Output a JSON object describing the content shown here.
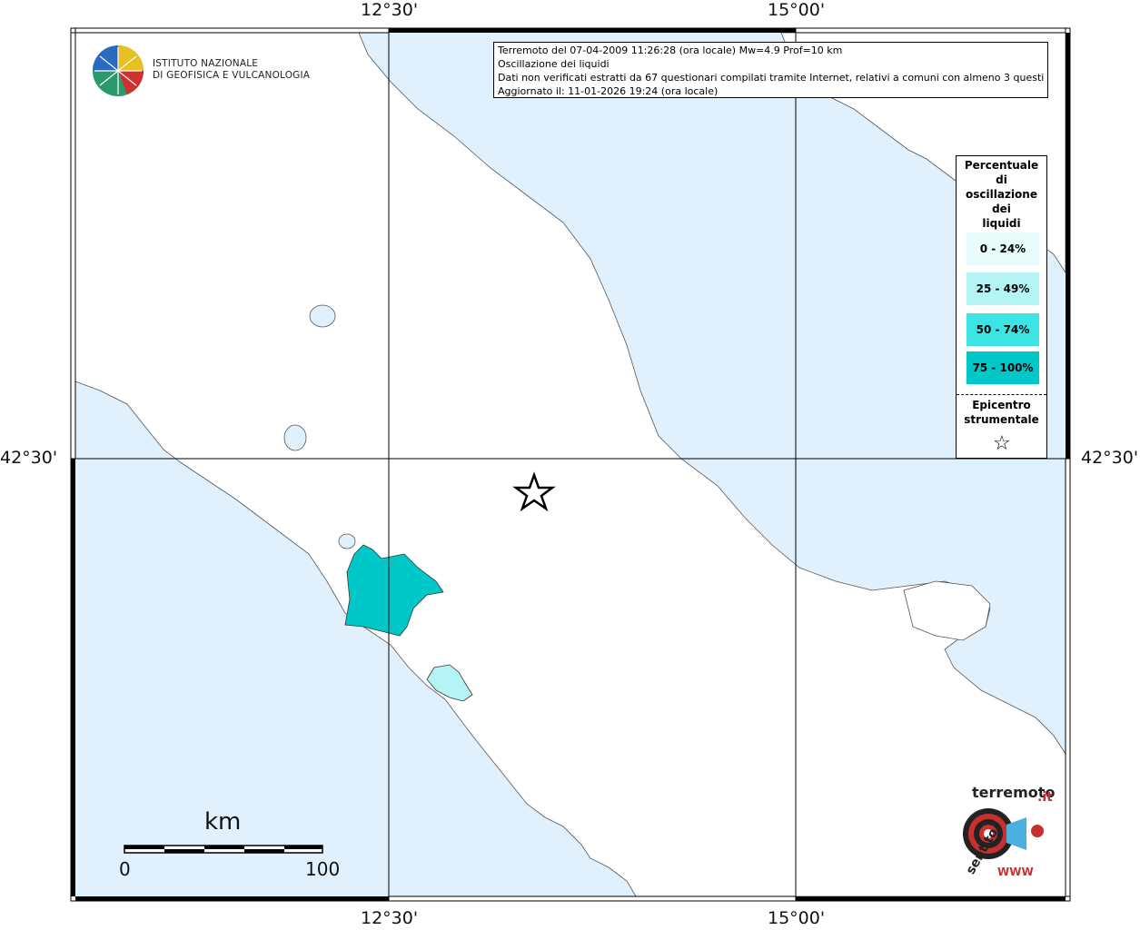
{
  "info": {
    "line1": "Terremoto del 07-04-2009 11:26:28 (ora locale) Mw=4.9 Prof=10 km",
    "line2": "Oscillazione dei liquidi",
    "line3": "Dati non verificati estratti da 67 questionari compilati tramite Internet, relativi a comuni con almeno 3 questionari.",
    "line4": "Aggiornato il: 11-01-2026 19:24 (ora locale)"
  },
  "institute": {
    "line1": "ISTITUTO NAZIONALE",
    "line2": "DI GEOFISICA E VULCANOLOGIA"
  },
  "axis_labels": {
    "top_left": "12°30'",
    "top_right": "15°00'",
    "bottom_left": "12°30'",
    "bottom_right": "15°00'",
    "left": "42°30'",
    "right": "42°30'"
  },
  "legend": {
    "title_lines": [
      "Percentuale",
      "di",
      "oscillazione",
      "dei",
      "liquidi"
    ],
    "items": [
      {
        "label": "0 - 24%",
        "color": "#e8fcfc"
      },
      {
        "label": "25 - 49%",
        "color": "#b4f4f4"
      },
      {
        "label": "50 - 74%",
        "color": "#3ce4e4"
      },
      {
        "label": "75 - 100%",
        "color": "#00c8c8"
      }
    ],
    "epicenter_lines": [
      "Epicentro",
      "strumentale"
    ]
  },
  "scale": {
    "title": "km",
    "start": "0",
    "end": "100"
  },
  "colors": {
    "sea": "#e0f0fc",
    "land": "#ffffff",
    "rome_area": "#00c8c8",
    "latina_area": "#b4f4f4",
    "border": "#000000"
  },
  "watermark": {
    "main": "sentitoilterremoto.it",
    "sub": "WWW.ingv"
  }
}
